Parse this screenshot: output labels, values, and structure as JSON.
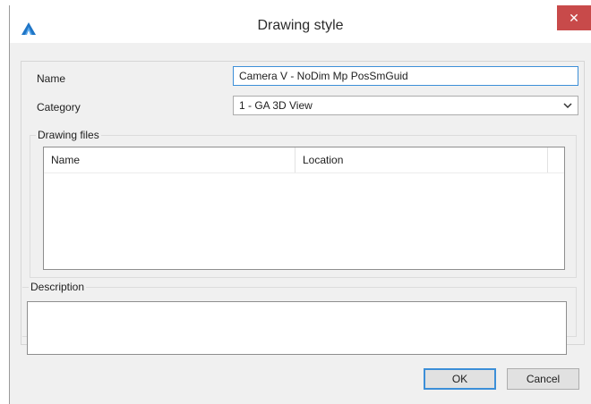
{
  "window": {
    "title": "Drawing style",
    "close_glyph": "✕"
  },
  "form": {
    "name_label": "Name",
    "name_value": "Camera V - NoDim Mp PosSmGuid",
    "category_label": "Category",
    "category_value": "1 - GA 3D View"
  },
  "drawing_files": {
    "legend": "Drawing files",
    "columns": [
      "Name",
      "Location"
    ]
  },
  "description": {
    "legend": "Description",
    "value": ""
  },
  "buttons": {
    "ok": "OK",
    "cancel": "Cancel"
  },
  "colors": {
    "accent": "#3c8fd8",
    "close": "#c84a4a"
  },
  "icons": {
    "app": "autodesk-logo-icon",
    "close": "close-icon",
    "dropdown": "chevron-down-icon"
  }
}
